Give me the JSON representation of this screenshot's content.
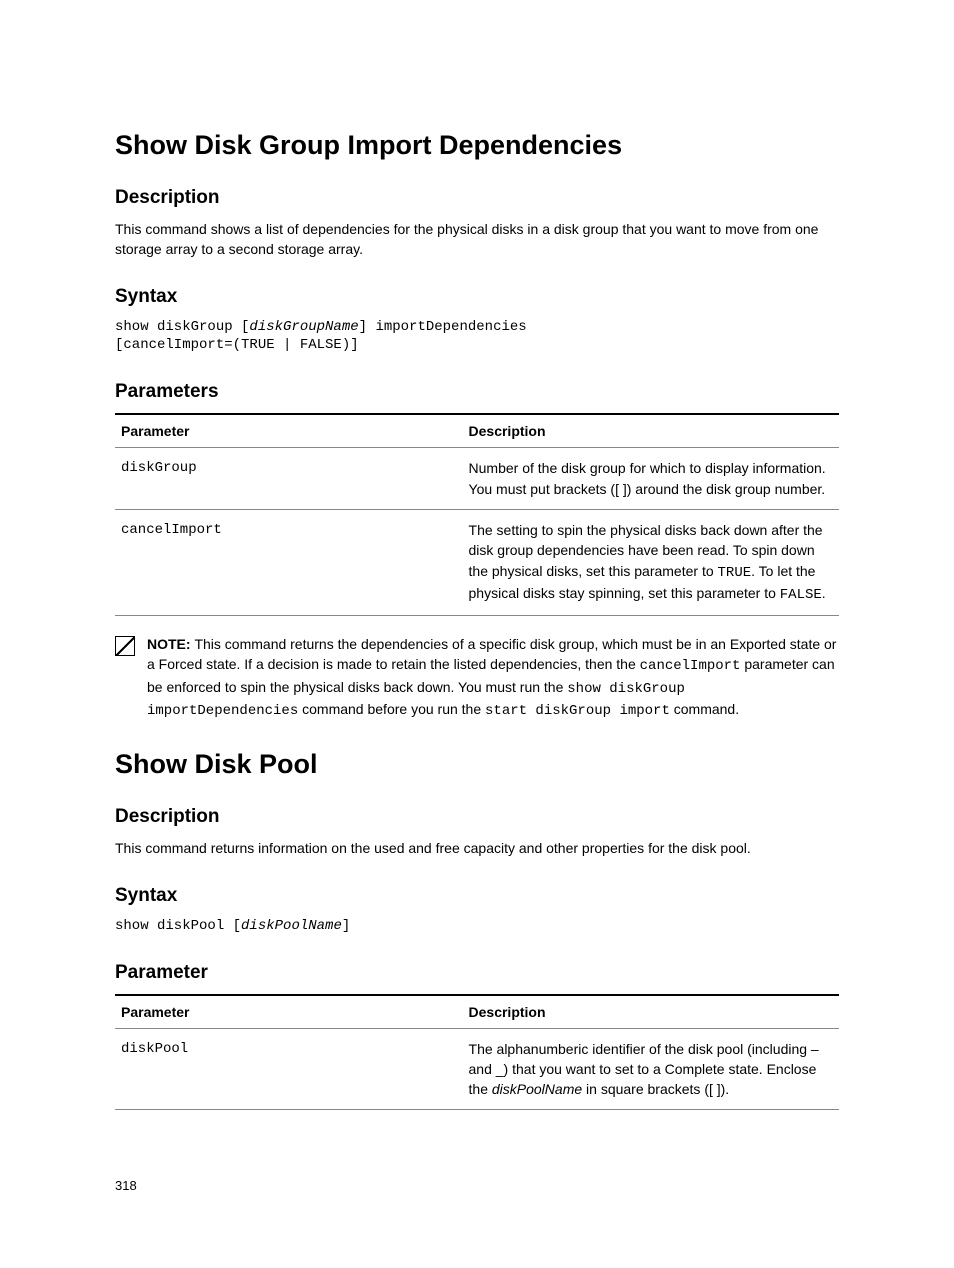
{
  "section1": {
    "title": "Show Disk Group Import Dependencies",
    "desc_heading": "Description",
    "desc_text": "This command shows a list of dependencies for the physical disks in a disk group that you want to move from one storage array to a second storage array.",
    "syntax_heading": "Syntax",
    "syntax_code_pre": "show diskGroup [",
    "syntax_code_var": "diskGroupName",
    "syntax_code_post": "] importDependencies\n[cancelImport=(TRUE | FALSE)]",
    "params_heading": "Parameters",
    "th_param": "Parameter",
    "th_desc": "Description",
    "rows": [
      {
        "name": "diskGroup",
        "desc": "Number of the disk group for which to display information. You must put brackets ([ ]) around the disk group number."
      },
      {
        "name": "cancelImport",
        "desc_pre": "The setting to spin the physical disks back down after the disk group dependencies have been read. To spin down the physical disks, set this parameter to ",
        "true": "TRUE",
        "desc_mid": ". To let the physical disks stay spinning, set this parameter to ",
        "false": "FALSE",
        "desc_post": "."
      }
    ],
    "note": {
      "label": "NOTE: ",
      "t1": "This command returns the dependencies of a specific disk group, which must be in an Exported state or a Forced state. If a decision is made to retain the listed dependencies, then the ",
      "c1": "cancelImport",
      "t2": " parameter can be enforced to spin the physical disks back down. You must run the ",
      "c2": "show diskGroup importDependencies",
      "t3": " command before you run the ",
      "c3": "start diskGroup import",
      "t4": " command."
    }
  },
  "section2": {
    "title": "Show Disk Pool",
    "desc_heading": "Description",
    "desc_text": "This command returns information on the used and free capacity and other properties for the disk pool.",
    "syntax_heading": "Syntax",
    "syntax_code_pre": "show diskPool [",
    "syntax_code_var": "diskPoolName",
    "syntax_code_post": "]",
    "params_heading": "Parameter",
    "th_param": "Parameter",
    "th_desc": "Description",
    "row": {
      "name": "diskPool",
      "desc_pre": "The alphanumberic identifier of the disk pool (including – and _) that you want to set to a Complete state. Enclose the ",
      "var": "diskPoolName",
      "desc_post": " in square brackets ([ ])."
    }
  },
  "page_number": "318"
}
